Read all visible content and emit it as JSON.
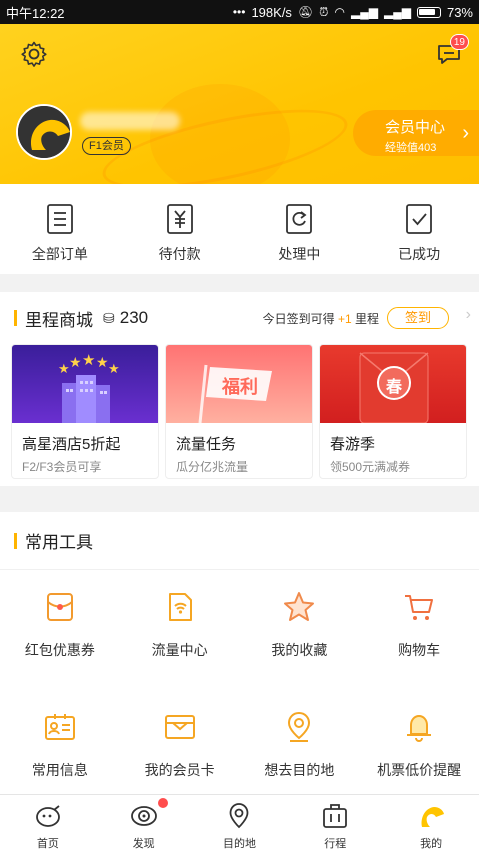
{
  "status_bar": {
    "time": "中午12:22",
    "network_speed": "198K/s",
    "battery": "73%"
  },
  "header": {
    "message_badge": "19",
    "member_level": "F1会员",
    "vip_center": {
      "title": "会员中心",
      "experience": "经验值403"
    }
  },
  "orders": [
    {
      "label": "全部订单",
      "icon": "all-orders-icon"
    },
    {
      "label": "待付款",
      "icon": "pending-payment-icon"
    },
    {
      "label": "处理中",
      "icon": "processing-icon"
    },
    {
      "label": "已成功",
      "icon": "success-icon"
    }
  ],
  "mall": {
    "title": "里程商城",
    "points": "230",
    "checkin_hint_prefix": "今日签到可得",
    "checkin_hint_plus": "+1",
    "checkin_hint_suffix": "里程",
    "checkin_button": "签到",
    "cards": [
      {
        "title": "高星酒店5折起",
        "subtitle": "F2/F3会员可享",
        "image_text": ""
      },
      {
        "title": "流量任务",
        "subtitle": "瓜分亿兆流量",
        "image_text": "福利"
      },
      {
        "title": "春游季",
        "subtitle": "领500元满减券",
        "image_text": "春"
      }
    ]
  },
  "tools": {
    "title": "常用工具",
    "items": [
      {
        "label": "红包优惠券",
        "icon": "coupon-icon"
      },
      {
        "label": "流量中心",
        "icon": "data-center-icon"
      },
      {
        "label": "我的收藏",
        "icon": "favorites-icon"
      },
      {
        "label": "购物车",
        "icon": "cart-icon"
      },
      {
        "label": "常用信息",
        "icon": "contact-info-icon"
      },
      {
        "label": "我的会员卡",
        "icon": "member-card-icon"
      },
      {
        "label": "想去目的地",
        "icon": "destination-icon"
      },
      {
        "label": "机票低价提醒",
        "icon": "bell-icon"
      }
    ]
  },
  "tabbar": [
    {
      "label": "首页",
      "icon": "home-icon"
    },
    {
      "label": "发现",
      "icon": "discover-icon"
    },
    {
      "label": "目的地",
      "icon": "map-pin-icon"
    },
    {
      "label": "行程",
      "icon": "trip-icon"
    },
    {
      "label": "我的",
      "icon": "profile-icon"
    }
  ],
  "colors": {
    "brand_yellow": "#ffc400",
    "accent_orange": "#ff9900",
    "tool_icon": "#f5a623"
  }
}
